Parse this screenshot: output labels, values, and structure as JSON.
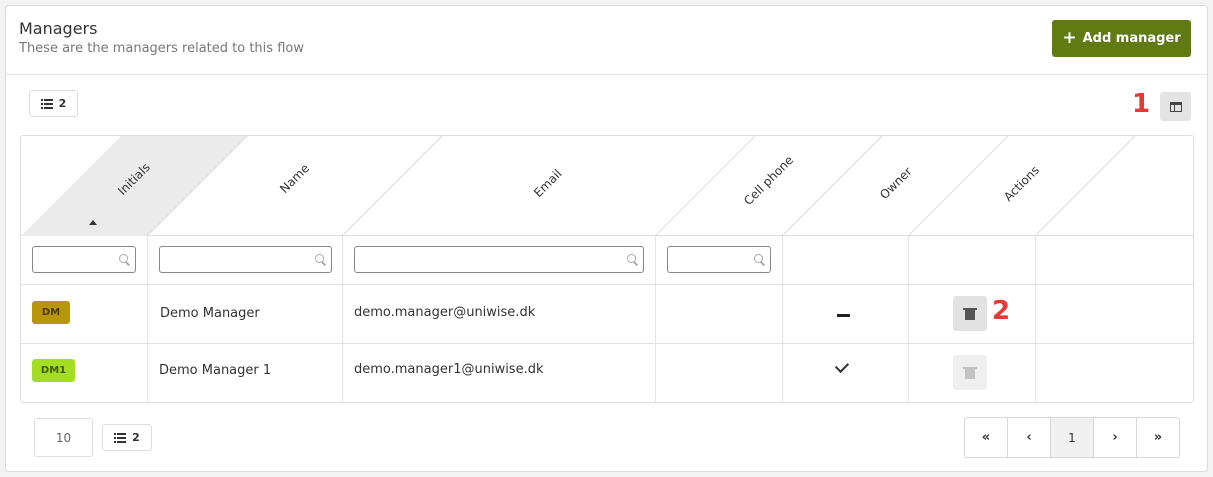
{
  "header": {
    "title": "Managers",
    "subtitle": "These are the managers related to this flow",
    "add_button_label": "Add manager",
    "accent_color": "#5f7b12"
  },
  "toolbar": {
    "list_count": "2",
    "marker_1": "1",
    "column_toggle_icon": "columns-icon"
  },
  "columns": [
    "Initials",
    "Name",
    "Email",
    "Cell phone",
    "Owner",
    "Actions"
  ],
  "sort": {
    "column": "Initials",
    "direction": "ascending"
  },
  "rows": [
    {
      "initials": "DM",
      "badge_color": "#b8960c",
      "name": "Demo Manager",
      "email": "demo.manager@uniwise.dk",
      "cell_phone": "",
      "owner": false,
      "delete_enabled": true
    },
    {
      "initials": "DM1",
      "badge_color": "#a4de22",
      "name": "Demo Manager 1",
      "email": "demo.manager1@uniwise.dk",
      "cell_phone": "",
      "owner": true,
      "delete_enabled": false
    }
  ],
  "marker_2": "2",
  "footer": {
    "page_size": "10",
    "list_count": "2",
    "pager": {
      "first": "«",
      "prev": "‹",
      "current": "1",
      "next": "›",
      "last": "»"
    }
  }
}
